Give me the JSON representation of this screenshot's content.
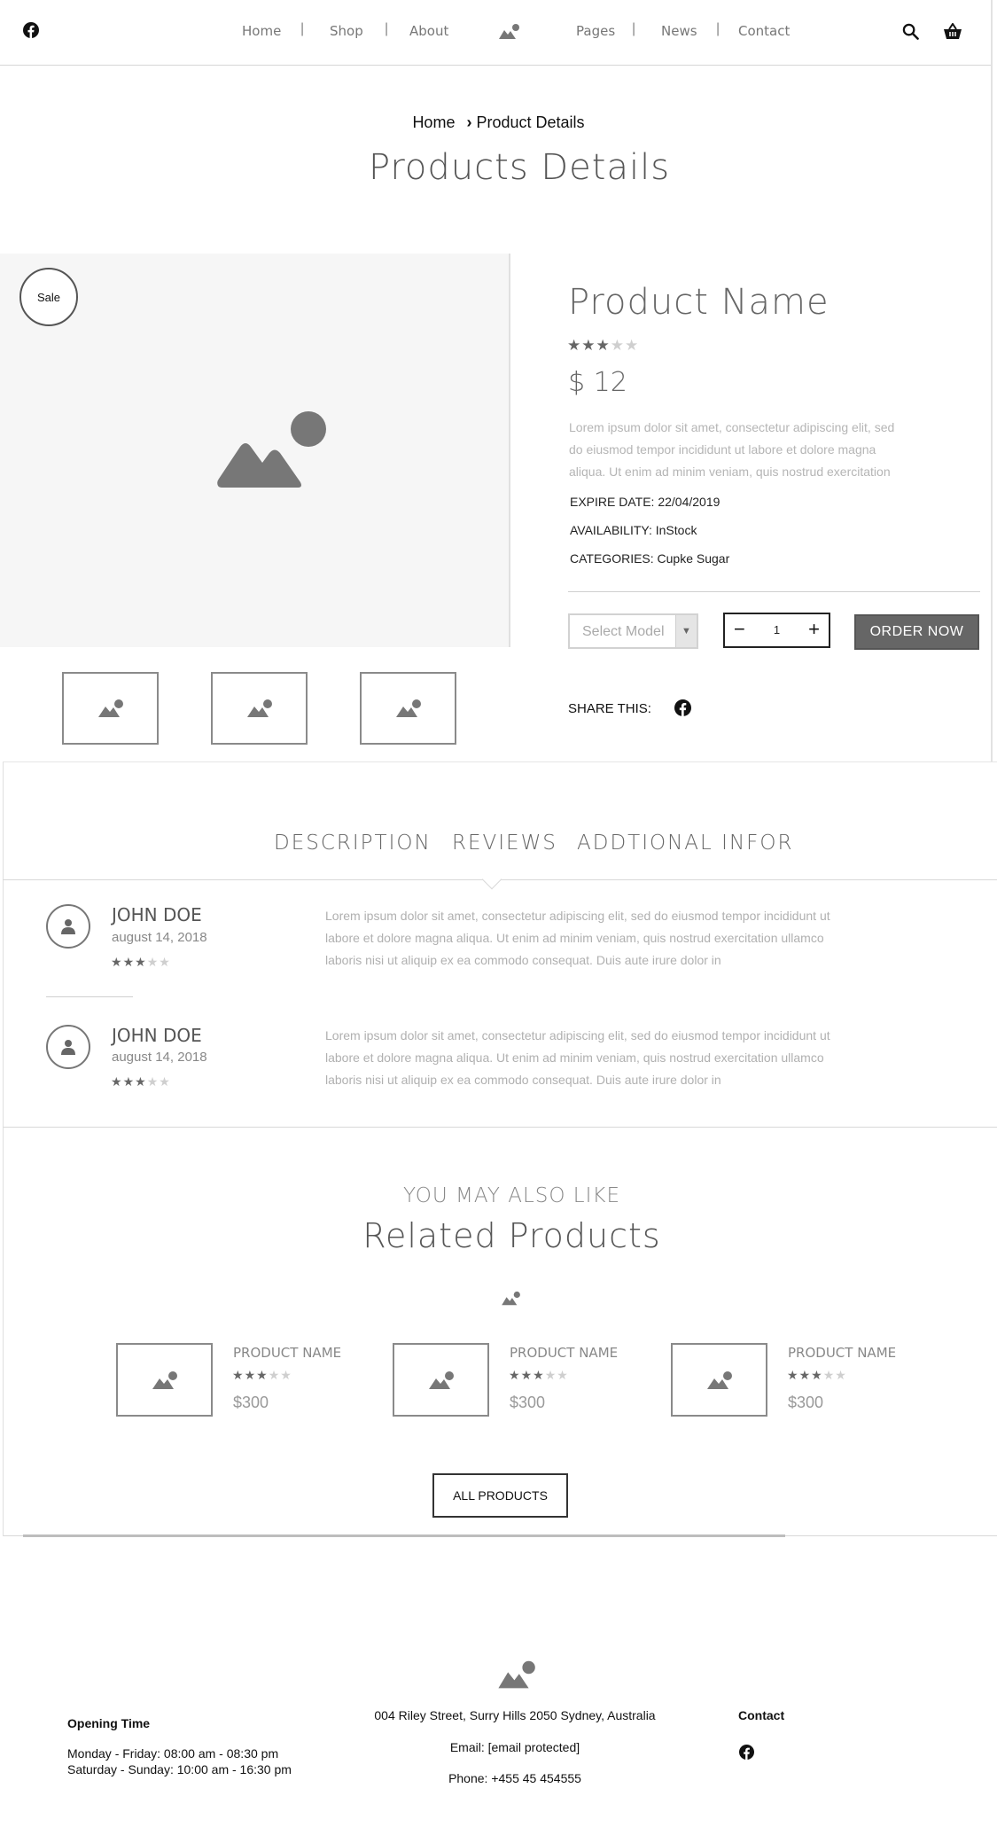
{
  "header": {
    "nav": [
      "Home",
      "Shop",
      "About",
      "Pages",
      "News",
      "Contact"
    ]
  },
  "breadcrumb": {
    "home": "Home",
    "current": "Product Details"
  },
  "page_title": "Products Details",
  "product": {
    "badge": "Sale",
    "name": "Product Name",
    "rating": 3,
    "rating_max": 5,
    "price": "$ 12",
    "description": "Lorem ipsum dolor sit amet, consectetur adipiscing elit, sed do eiusmod tempor incididunt ut labore et dolore magna aliqua. Ut enim ad minim veniam, quis nostrud exercitation",
    "expire": "EXPIRE DATE: 22/04/2019",
    "availability": "AVAILABILITY: InStock",
    "categories": "CATEGORIES: Cupke Sugar",
    "select_placeholder": "Select Model",
    "quantity": "1",
    "order_label": "ORDER NOW",
    "share_label": "SHARE THIS:"
  },
  "tabs": [
    "DESCRIPTION",
    "REVIEWS",
    "ADDTIONAL INFOR"
  ],
  "reviews": [
    {
      "name": "JOHN DOE",
      "date": "august 14, 2018",
      "rating": 3,
      "text": "Lorem ipsum dolor sit amet, consectetur adipiscing elit, sed do eiusmod tempor incididunt ut labore et dolore magna aliqua. Ut enim ad minim veniam, quis nostrud exercitation ullamco laboris nisi ut aliquip ex ea commodo consequat. Duis aute irure dolor in"
    },
    {
      "name": "JOHN DOE",
      "date": "august 14, 2018",
      "rating": 3,
      "text": "Lorem ipsum dolor sit amet, consectetur adipiscing elit, sed do eiusmod tempor incididunt ut labore et dolore magna aliqua. Ut enim ad minim veniam, quis nostrud exercitation ullamco laboris nisi ut aliquip ex ea commodo consequat. Duis aute irure dolor in"
    }
  ],
  "related": {
    "kicker": "YOU MAY ALSO LIKE",
    "title": "Related Products",
    "items": [
      {
        "name": "PRODUCT NAME",
        "rating": 3,
        "price": "$300"
      },
      {
        "name": "PRODUCT NAME",
        "rating": 3,
        "price": "$300"
      },
      {
        "name": "PRODUCT NAME",
        "rating": 3,
        "price": "$300"
      }
    ],
    "all_label": "ALL PRODUCTS"
  },
  "footer": {
    "opening_heading": "Opening Time",
    "weekday": "Monday - Friday: 08:00 am - 08:30 pm",
    "weekend": "Saturday - Sunday: 10:00 am - 16:30 pm",
    "address": "004 Riley Street, Surry Hills 2050 Sydney, Australia",
    "email": "Email: [email protected]",
    "phone": "Phone: +455 45 454555",
    "contact_heading": "Contact"
  },
  "colors": {
    "accent": "#666666",
    "star_off": "#cfcfcf",
    "muted_text": "#b0b0b0"
  },
  "icons": [
    "facebook-icon",
    "logo-mountain-icon",
    "search-icon",
    "basket-icon",
    "image-placeholder-icon",
    "user-icon"
  ]
}
